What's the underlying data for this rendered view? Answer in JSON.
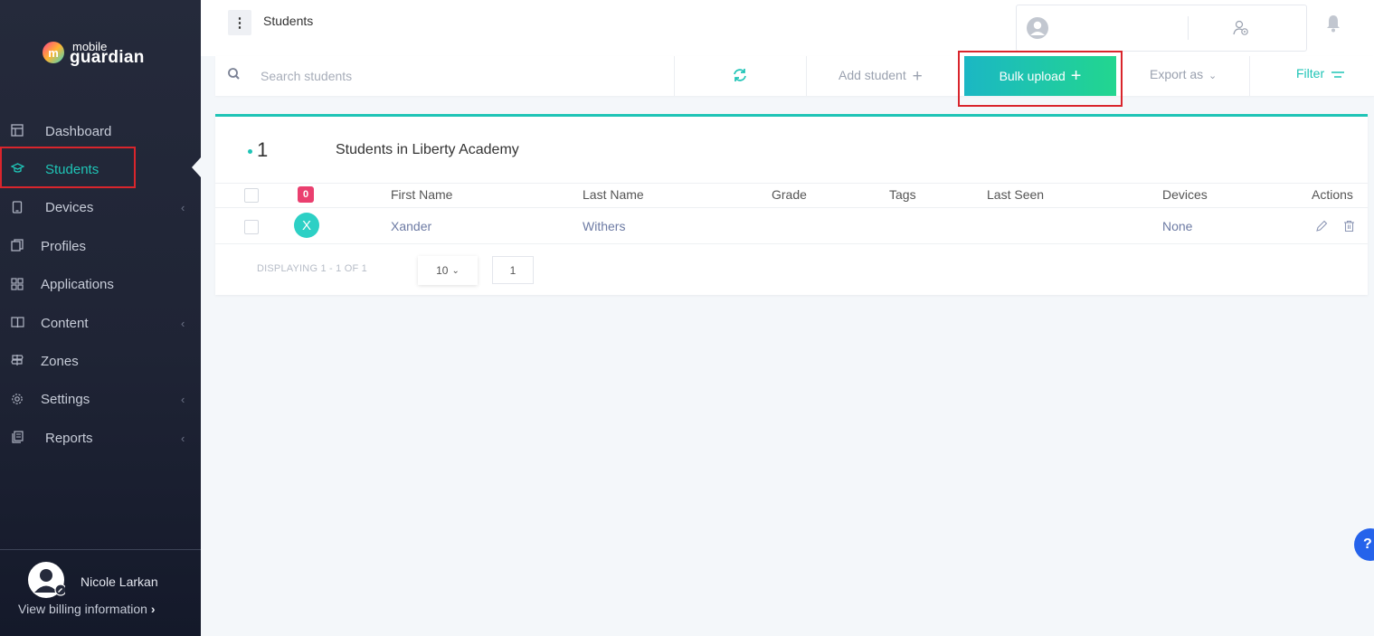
{
  "brand": {
    "line1": "mobile",
    "line2": "guardian",
    "badge_letter": "m"
  },
  "sidebar": {
    "items": [
      {
        "label": "Dashboard",
        "icon": "dashboard-icon",
        "has_chevron": false
      },
      {
        "label": "Students",
        "icon": "graduation-cap-icon",
        "active": true
      },
      {
        "label": "Devices",
        "icon": "tablet-icon",
        "has_chevron": true
      },
      {
        "label": "Profiles",
        "icon": "profiles-icon"
      },
      {
        "label": "Applications",
        "icon": "grid-icon"
      },
      {
        "label": "Content",
        "icon": "book-icon",
        "has_chevron": true
      },
      {
        "label": "Zones",
        "icon": "signpost-icon"
      },
      {
        "label": "Settings",
        "icon": "gear-icon",
        "has_chevron": true
      },
      {
        "label": "Reports",
        "icon": "report-icon",
        "has_chevron": true
      }
    ],
    "user": {
      "name": "Nicole Larkan",
      "billing_link": "View billing information"
    }
  },
  "header": {
    "title": "Students"
  },
  "toolbar": {
    "search_placeholder": "Search students",
    "add_student": "Add student",
    "bulk_upload": "Bulk upload",
    "export_as": "Export as",
    "filter": "Filter"
  },
  "card": {
    "count": "1",
    "title": "Students in Liberty Academy",
    "badge_count": "0",
    "columns": [
      "First Name",
      "Last Name",
      "Grade",
      "Tags",
      "Last Seen",
      "Devices",
      "Actions"
    ],
    "rows": [
      {
        "initial": "X",
        "first_name": "Xander",
        "last_name": "Withers",
        "grade": "",
        "tags": "",
        "last_seen": "",
        "devices": "None"
      }
    ],
    "pagination": {
      "displaying": "DISPLAYING 1 - 1 OF 1",
      "page_size": "10",
      "page": "1"
    }
  },
  "colors": {
    "accent": "#1fc4b6",
    "sidebar_bg": "#252a3b",
    "highlight": "#d9252c",
    "badge": "#ea3f6f"
  }
}
